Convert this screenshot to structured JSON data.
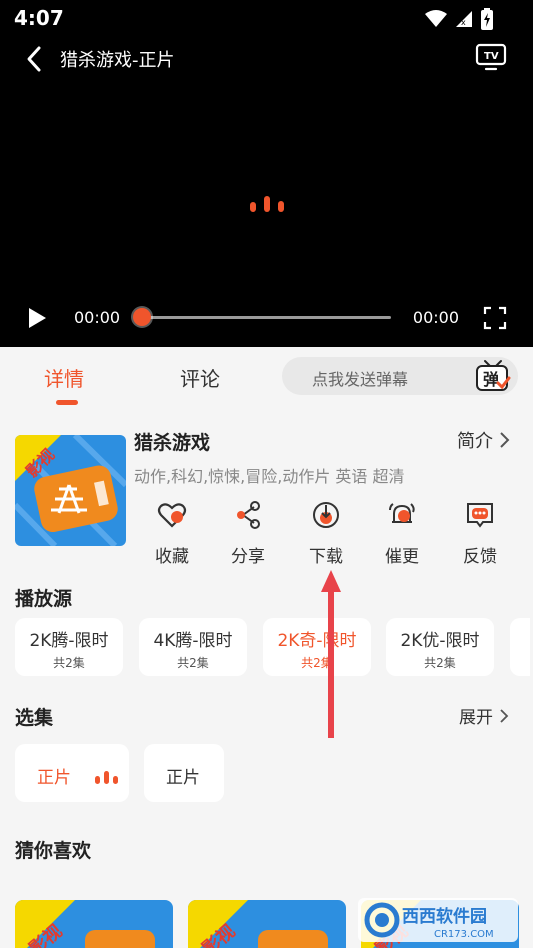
{
  "status_bar": {
    "time": "4:07"
  },
  "player": {
    "title": "猎杀游戏-正片",
    "current_time": "00:00",
    "total_time": "00:00",
    "progress": 0
  },
  "tabs": [
    {
      "label": "详情",
      "active": true
    },
    {
      "label": "评论",
      "active": false
    }
  ],
  "danmaku": {
    "placeholder": "点我发送弹幕",
    "icon_text": "弹"
  },
  "movie": {
    "poster_text": "影视",
    "name": "猎杀游戏",
    "intro_label": "简介",
    "tags": "动作,科幻,惊悚,冒险,动作片  英语  超清"
  },
  "actions": [
    {
      "label": "收藏",
      "icon": "heart-icon"
    },
    {
      "label": "分享",
      "icon": "share-icon"
    },
    {
      "label": "下载",
      "icon": "download-icon"
    },
    {
      "label": "催更",
      "icon": "bell-icon"
    },
    {
      "label": "反馈",
      "icon": "feedback-icon"
    }
  ],
  "sources": {
    "title": "播放源",
    "items": [
      {
        "name": "2K腾-限时",
        "count": "共2集",
        "active": false
      },
      {
        "name": "4K腾-限时",
        "count": "共2集",
        "active": false
      },
      {
        "name": "2K奇-限时",
        "count": "共2集",
        "active": true
      },
      {
        "name": "2K优-限时",
        "count": "共2集",
        "active": false
      }
    ]
  },
  "episodes": {
    "title": "选集",
    "expand_label": "展开",
    "items": [
      {
        "label": "正片",
        "active": true
      },
      {
        "label": "正片",
        "active": false
      }
    ]
  },
  "recommend": {
    "title": "猜你喜欢",
    "card_text": "影视"
  },
  "watermark": {
    "text": "西西软件园",
    "sub": "CR173.COM"
  },
  "colors": {
    "accent": "#f0552c",
    "poster_blue": "#2d8fe0",
    "poster_yellow": "#f5d800",
    "poster_orange": "#f08a1e"
  }
}
